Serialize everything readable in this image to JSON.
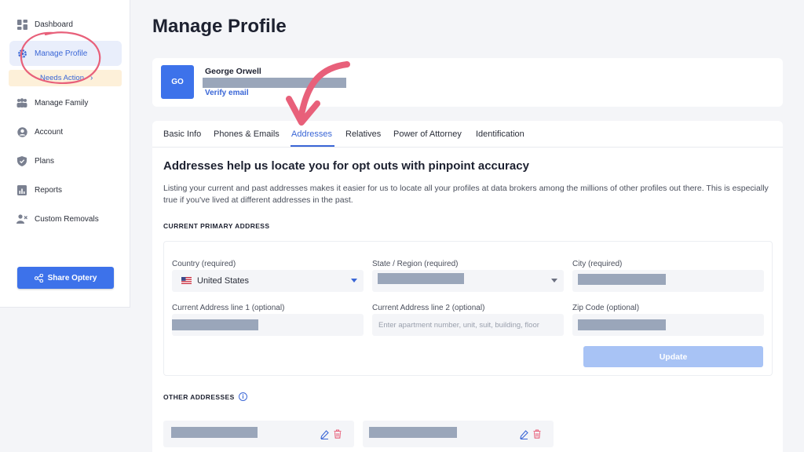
{
  "sidebar": {
    "items": [
      {
        "label": "Dashboard",
        "icon": "dashboard-icon"
      },
      {
        "label": "Manage Profile",
        "icon": "gear-icon"
      },
      {
        "label": "Manage Family",
        "icon": "family-icon"
      },
      {
        "label": "Account",
        "icon": "user-circle-icon"
      },
      {
        "label": "Plans",
        "icon": "shield-icon"
      },
      {
        "label": "Reports",
        "icon": "report-icon"
      },
      {
        "label": "Custom Removals",
        "icon": "user-remove-icon"
      }
    ],
    "needs_action": "Needs Action",
    "share_button": "Share Optery"
  },
  "page": {
    "title": "Manage Profile"
  },
  "profile": {
    "initials": "GO",
    "name": "George Orwell",
    "verify_link": "Verify email"
  },
  "tabs": [
    {
      "label": "Basic Info"
    },
    {
      "label": "Phones & Emails"
    },
    {
      "label": "Addresses",
      "active": true
    },
    {
      "label": "Relatives"
    },
    {
      "label": "Power of Attorney"
    },
    {
      "label": "Identification"
    }
  ],
  "addresses": {
    "heading": "Addresses help us locate you for opt outs with pinpoint accuracy",
    "description": "Listing your current and past addresses makes it easier for us to locate all your profiles at data brokers among the millions of other profiles out there. This is especially true if you've lived at different addresses in the past.",
    "current_primary_heading": "CURRENT PRIMARY ADDRESS",
    "fields": {
      "country_label": "Country (required)",
      "country_value": "United States",
      "state_label": "State / Region (required)",
      "city_label": "City (required)",
      "line1_label": "Current Address line 1 (optional)",
      "line2_label": "Current Address line 2 (optional)",
      "line2_placeholder": "Enter apartment number, unit, suit, building, floor",
      "zip_label": "Zip Code (optional)"
    },
    "update_button": "Update",
    "other_heading": "OTHER ADDRESSES",
    "info_icon": "i"
  },
  "colors": {
    "accent": "#3d72ea",
    "annotation": "#e8607a",
    "needs_action_bg": "#fdf0d9",
    "redaction": "#9aa6ba"
  }
}
